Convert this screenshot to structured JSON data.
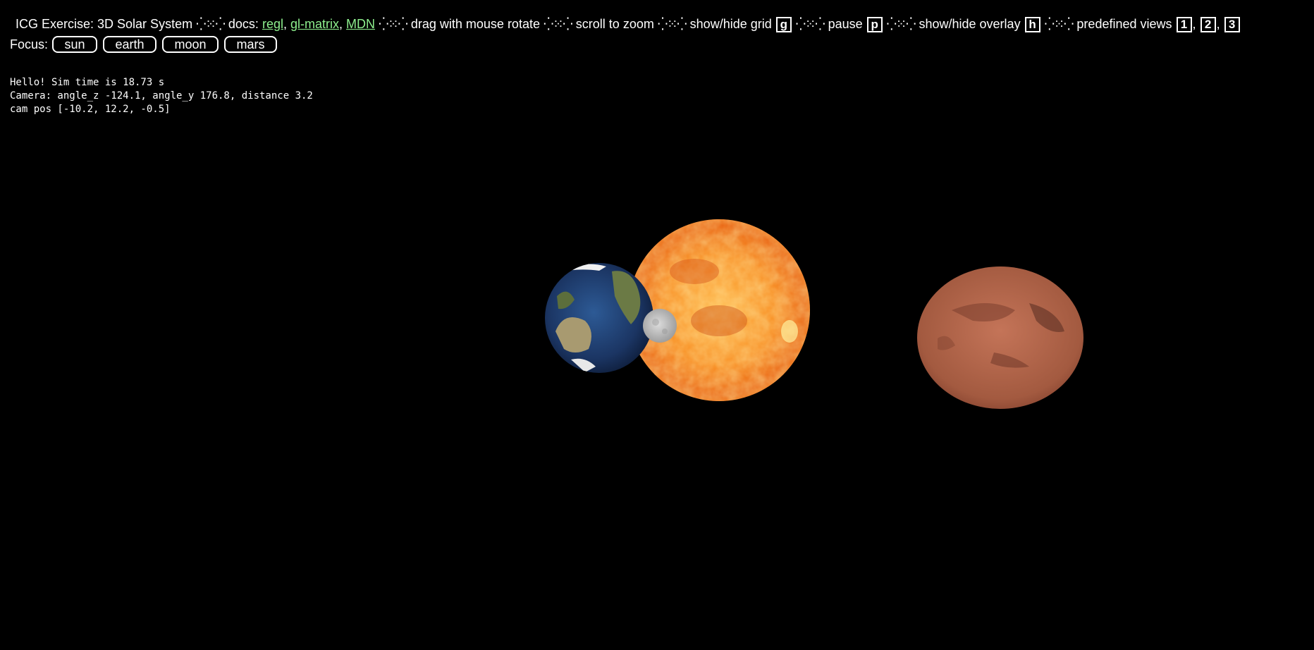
{
  "header": {
    "title": "ICG Exercise: 3D Solar System",
    "separator": "⁛⁙⁛",
    "docs_label": "docs:",
    "docs_links": [
      "regl",
      "gl-matrix",
      "MDN"
    ],
    "comma": ",",
    "hint_drag": "drag with mouse rotate",
    "hint_scroll": "scroll to zoom",
    "hint_grid": "show/hide grid",
    "key_grid": "g",
    "hint_pause": "pause",
    "key_pause": "p",
    "hint_overlay": "show/hide overlay",
    "key_overlay": "h",
    "hint_views": "predefined views",
    "view_keys": [
      "1",
      "2",
      "3"
    ]
  },
  "focus": {
    "label": "Focus:",
    "buttons": [
      "sun",
      "earth",
      "moon",
      "mars"
    ]
  },
  "overlay": {
    "line1": "Hello! Sim time is 18.73 s",
    "line2": "Camera: angle_z -124.1, angle_y 176.8, distance 3.2",
    "line3": "cam pos [-10.2, 12.2, -0.5]"
  },
  "colors": {
    "background": "#000000",
    "link": "#8ef08e",
    "sun_core": "#ffb13a",
    "sun_edge": "#e25a08",
    "earth_ocean": "#1e3a6e",
    "earth_land": "#7a7a4e",
    "moon": "#bdbdbd",
    "mars": "#b0634a"
  }
}
